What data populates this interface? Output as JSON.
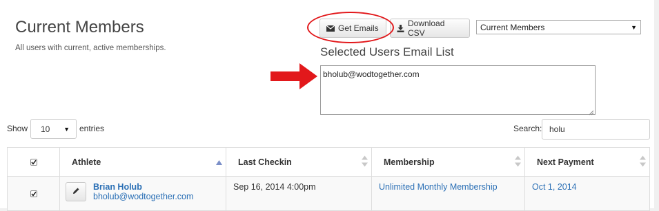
{
  "header": {
    "title": "Current Members",
    "subtitle": "All users with current, active memberships."
  },
  "toolbar": {
    "get_emails_label": "Get Emails",
    "download_csv_label": "Download CSV",
    "member_filter_value": "Current Members"
  },
  "email_list": {
    "title": "Selected Users Email List",
    "value": "bholub@wodtogether.com"
  },
  "table_controls": {
    "show_label": "Show",
    "page_size_value": "10",
    "entries_label": "entries",
    "search_label": "Search:",
    "search_value": "holu"
  },
  "table": {
    "columns": [
      "Athlete",
      "Last Checkin",
      "Membership",
      "Next Payment"
    ],
    "rows": [
      {
        "selected": true,
        "athlete_name": "Brian Holub",
        "athlete_email": "bholub@wodtogether.com",
        "last_checkin": "Sep 16, 2014 4:00pm",
        "membership": "Unlimited Monthly Membership",
        "next_payment": "Oct 1, 2014"
      }
    ]
  },
  "annotation_color": "#e2181b",
  "link_color": "#2a6fb5"
}
